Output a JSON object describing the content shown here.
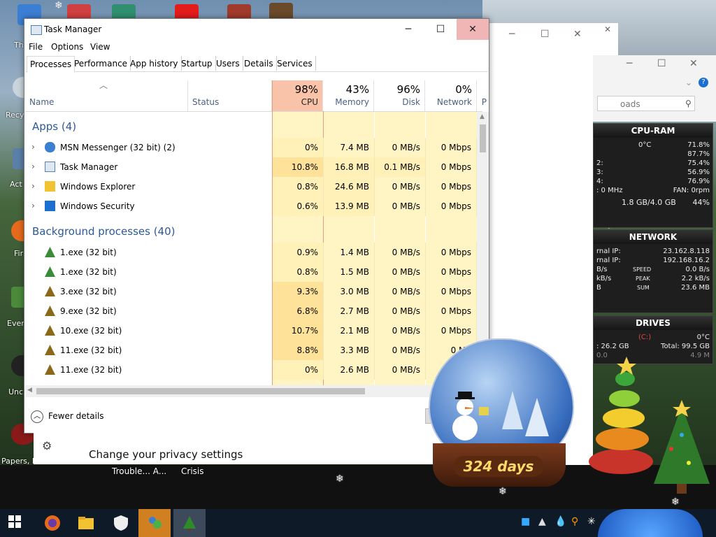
{
  "task_manager": {
    "title": "Task Manager",
    "menu": [
      "File",
      "Options",
      "View"
    ],
    "tabs": [
      "Processes",
      "Performance",
      "App history",
      "Startup",
      "Users",
      "Details",
      "Services"
    ],
    "active_tab": "Processes",
    "columns": {
      "name": "Name",
      "status": "Status",
      "cpu": {
        "pct": "98%",
        "label": "CPU"
      },
      "memory": {
        "pct": "43%",
        "label": "Memory"
      },
      "disk": {
        "pct": "96%",
        "label": "Disk"
      },
      "network": {
        "pct": "0%",
        "label": "Network"
      },
      "power_stub": "P"
    },
    "groups": {
      "apps": "Apps (4)",
      "background": "Background processes (40)"
    },
    "apps": [
      {
        "name": "MSN Messenger (32 bit) (2)",
        "cpu": "0%",
        "memory": "7.4 MB",
        "disk": "0 MB/s",
        "network": "0 Mbps"
      },
      {
        "name": "Task Manager",
        "cpu": "10.8%",
        "memory": "16.8 MB",
        "disk": "0.1 MB/s",
        "network": "0 Mbps"
      },
      {
        "name": "Windows Explorer",
        "cpu": "0.8%",
        "memory": "24.6 MB",
        "disk": "0 MB/s",
        "network": "0 Mbps"
      },
      {
        "name": "Windows Security",
        "cpu": "0.6%",
        "memory": "13.9 MB",
        "disk": "0 MB/s",
        "network": "0 Mbps"
      }
    ],
    "background": [
      {
        "name": "1.exe (32 bit)",
        "cpu": "0.9%",
        "memory": "1.4 MB",
        "disk": "0 MB/s",
        "network": "0 Mbps"
      },
      {
        "name": "1.exe (32 bit)",
        "cpu": "0.8%",
        "memory": "1.5 MB",
        "disk": "0 MB/s",
        "network": "0 Mbps"
      },
      {
        "name": "3.exe (32 bit)",
        "cpu": "9.3%",
        "memory": "3.0 MB",
        "disk": "0 MB/s",
        "network": "0 Mbps"
      },
      {
        "name": "9.exe (32 bit)",
        "cpu": "6.8%",
        "memory": "2.7 MB",
        "disk": "0 MB/s",
        "network": "0 Mbps"
      },
      {
        "name": "10.exe (32 bit)",
        "cpu": "10.7%",
        "memory": "2.1 MB",
        "disk": "0 MB/s",
        "network": "0 Mbps"
      },
      {
        "name": "11.exe (32 bit)",
        "cpu": "8.8%",
        "memory": "3.3 MB",
        "disk": "0 MB/s",
        "network": "0 Mb"
      },
      {
        "name": "11.exe (32 bit)",
        "cpu": "0%",
        "memory": "2.6 MB",
        "disk": "0 MB/s",
        "network": "0 Mbps"
      }
    ],
    "fewer_details": "Fewer details"
  },
  "privacy": {
    "text": "Change your privacy settings"
  },
  "desktop": {
    "icon_labels": [
      "Th",
      "Recy",
      "Act",
      "Fir",
      "Ever",
      "Unc",
      "Papers, P"
    ],
    "taskbar_labels": [
      "Trouble... A...",
      "Crisis"
    ],
    "explorer_search_placeholder": "oads"
  },
  "gadgets": {
    "cpu_ram": {
      "title": "CPU-RAM",
      "temp": "0°C",
      "total": "71.8%",
      "cores": [
        {
          "label": "",
          "value": "87.7%"
        },
        {
          "label": "2:",
          "value": "75.4%"
        },
        {
          "label": "3:",
          "value": "56.9%"
        },
        {
          "label": "4:",
          "value": "76.9%"
        }
      ],
      "freq": ": 0 MHz",
      "fan": "FAN: 0rpm",
      "ram": "1.8 GB/4.0 GB",
      "ram_pct": "44%"
    },
    "network": {
      "title": "NETWORK",
      "external_label": "rnal IP:",
      "external_ip": "23.162.8.118",
      "internal_label": "rnal IP:",
      "internal_ip": "192.168.16.2",
      "speed_label": "SPEED",
      "speed_unit": "B/s",
      "speed": "0.0 B/s",
      "peak_label": "PEAK",
      "peak_unit": "kB/s",
      "peak": "2.2 kB/s",
      "sum_label": "SUM",
      "sum_unit": "B",
      "sum": "23.6 MB"
    },
    "drives": {
      "title": "DRIVES",
      "drive": "(C:)",
      "temp": "0°C",
      "used": ": 26.2 GB",
      "total": "Total: 99.5 GB",
      "bar_left": "0.0",
      "bar_right": "4.9 M"
    }
  },
  "snow_globe": {
    "days": "324 days"
  },
  "colors": {
    "cpu_header": "#f8c3a8",
    "cell_light": "#fff4c4",
    "cell_mid": "#ffeaa4",
    "group_text": "#2c5a95"
  }
}
